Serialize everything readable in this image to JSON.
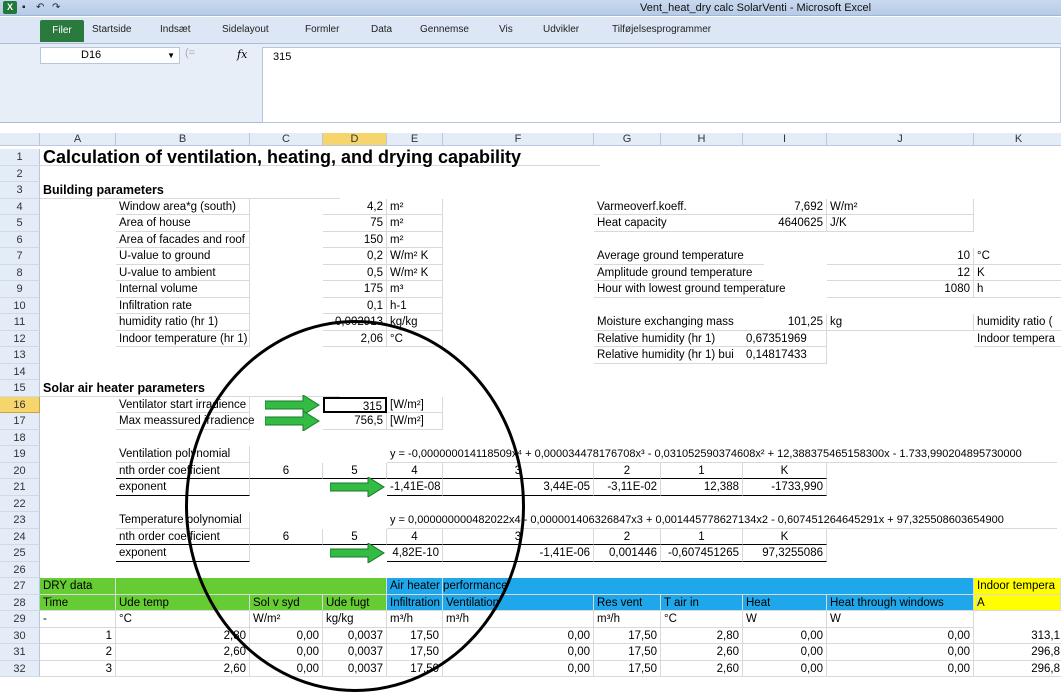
{
  "titlebar": {
    "app_icon": "X",
    "window_title": "Vent_heat_dry calc SolarVenti  -  Microsoft Excel"
  },
  "ribbon": {
    "file_tab": "Filer",
    "tabs": [
      "Startside",
      "Indsæt",
      "Sidelayout",
      "Formler",
      "Data",
      "Gennemse",
      "Vis",
      "Udvikler",
      "Tilføjelsesprogrammer"
    ]
  },
  "formula_bar": {
    "name_box": "D16",
    "fx": "fx",
    "value": "315"
  },
  "columns": [
    "A",
    "B",
    "C",
    "D",
    "E",
    "F",
    "G",
    "H",
    "I",
    "J",
    "K"
  ],
  "rows": [
    {
      "n": "1",
      "cells": {
        "A": "Calculation of ventilation, heating, and drying capability"
      }
    },
    {
      "n": "2",
      "cells": {}
    },
    {
      "n": "3",
      "cells": {
        "A": "Building parameters"
      }
    },
    {
      "n": "4",
      "cells": {
        "B": "Window area*g (south)",
        "D": "4,2",
        "E": "m²",
        "G": "Varmeoverf.koeff.",
        "I": "7,692",
        "J": "W/m²"
      }
    },
    {
      "n": "5",
      "cells": {
        "B": "Area of house",
        "D": "75",
        "E": "m²",
        "G": "Heat capacity",
        "I": "4640625",
        "J": "J/K"
      }
    },
    {
      "n": "6",
      "cells": {
        "B": "Area of facades and roof",
        "D": "150",
        "E": "m²"
      }
    },
    {
      "n": "7",
      "cells": {
        "B": "U-value to ground",
        "D": "0,2",
        "E": "W/m² K",
        "G": "Average ground temperature",
        "J": "10",
        "K": "°C"
      }
    },
    {
      "n": "8",
      "cells": {
        "B": "U-value to ambient",
        "D": "0,5",
        "E": "W/m² K",
        "G": "Amplitude ground temperature",
        "J": "12",
        "K": "K"
      }
    },
    {
      "n": "9",
      "cells": {
        "B": "Internal volume",
        "D": "175",
        "E": "m³",
        "G": "Hour with lowest ground temperature",
        "J": "1080",
        "K": "h"
      }
    },
    {
      "n": "10",
      "cells": {
        "B": "Infiltration rate",
        "D": "0,1",
        "E": "h-1"
      }
    },
    {
      "n": "11",
      "cells": {
        "B": "humidity ratio (hr 1)",
        "D": "0,002913",
        "E": "kg/kg",
        "G": "Moisture exchanging mass",
        "I": "101,25",
        "J": "kg",
        "K": "humidity ratio ("
      }
    },
    {
      "n": "12",
      "cells": {
        "B": "Indoor temperature (hr 1)",
        "D": "2,06",
        "E": "°C",
        "G": "Relative humidity (hr 1)",
        "I": "0,67351969",
        "K": "Indoor tempera"
      }
    },
    {
      "n": "13",
      "cells": {
        "G": "Relative humidity (hr 1) bui",
        "I": "0,14817433"
      }
    },
    {
      "n": "14",
      "cells": {}
    },
    {
      "n": "15",
      "cells": {
        "A": "Solar air heater parameters"
      }
    },
    {
      "n": "16",
      "cells": {
        "B": "Ventilator start irradience",
        "D": "315",
        "E": "[W/m²]"
      }
    },
    {
      "n": "17",
      "cells": {
        "B": "Max meassured irradience",
        "D": "756,5",
        "E": "[W/m²]"
      }
    },
    {
      "n": "18",
      "cells": {}
    },
    {
      "n": "19",
      "cells": {
        "B": "Ventilation polynomial",
        "E": "y = -0,000000014118509x⁴ + 0,000034478176708x³ - 0,031052590374608x² + 12,388375465158300x - 1.733,990204895730000"
      }
    },
    {
      "n": "20",
      "cells": {
        "B": "nth order coefficient",
        "C": "6",
        "D": "5",
        "E": "4",
        "F": "3",
        "G": "2",
        "H": "1",
        "I": "K"
      }
    },
    {
      "n": "21",
      "cells": {
        "B": "exponent",
        "E": "-1,41E-08",
        "F": "3,44E-05",
        "G": "-3,11E-02",
        "H": "12,388",
        "I": "-1733,990"
      }
    },
    {
      "n": "22",
      "cells": {}
    },
    {
      "n": "23",
      "cells": {
        "B": "Temperature polynomial",
        "E": "y = 0,000000000482022x4 - 0,000001406326847x3 + 0,001445778627134x2 - 0,607451264645291x + 97,325508603654900"
      }
    },
    {
      "n": "24",
      "cells": {
        "B": "nth order coefficient",
        "C": "6",
        "D": "5",
        "E": "4",
        "F": "3",
        "G": "2",
        "H": "1",
        "I": "K"
      }
    },
    {
      "n": "25",
      "cells": {
        "B": "exponent",
        "E": "4,82E-10",
        "F": "-1,41E-06",
        "G": "0,001446",
        "H": "-0,607451265",
        "I": "97,3255086"
      }
    },
    {
      "n": "26",
      "cells": {}
    },
    {
      "n": "27",
      "cells": {
        "A": "DRY data",
        "E": "Air heater performance",
        "K": "Indoor tempera"
      }
    },
    {
      "n": "28",
      "cells": {
        "A": "Time",
        "B": "Ude temp",
        "C": "Sol v syd",
        "D": "Ude fugt",
        "E": "Infiltration",
        "F": "Ventilation",
        "G": "Res vent",
        "H": "T air in",
        "I": "Heat",
        "J": "Heat through windows",
        "K": "A"
      }
    },
    {
      "n": "29",
      "cells": {
        "A": "-",
        "B": "°C",
        "C": "W/m²",
        "D": "kg/kg",
        "E": "m³/h",
        "F": "m³/h",
        "G": "m³/h",
        "H": "°C",
        "I": "W",
        "J": "W"
      }
    },
    {
      "n": "30",
      "cells": {
        "A": "1",
        "B": "2,80",
        "C": "0,00",
        "D": "0,0037",
        "E": "17,50",
        "F": "0,00",
        "G": "17,50",
        "H": "2,80",
        "I": "0,00",
        "J": "0,00",
        "K": "313,1"
      }
    },
    {
      "n": "31",
      "cells": {
        "A": "2",
        "B": "2,60",
        "C": "0,00",
        "D": "0,0037",
        "E": "17,50",
        "F": "0,00",
        "G": "17,50",
        "H": "2,60",
        "I": "0,00",
        "J": "0,00",
        "K": "296,8"
      }
    },
    {
      "n": "32",
      "cells": {
        "A": "3",
        "B": "2,60",
        "C": "0,00",
        "D": "0,0037",
        "E": "17,50",
        "F": "0,00",
        "G": "17,50",
        "H": "2,60",
        "I": "0,00",
        "J": "0,00",
        "K": "296,8"
      }
    }
  ],
  "colors": {
    "green": "#66cc33",
    "blue": "#1ea7ea",
    "yellow": "#ffff00",
    "arrow": "#33bb44"
  }
}
